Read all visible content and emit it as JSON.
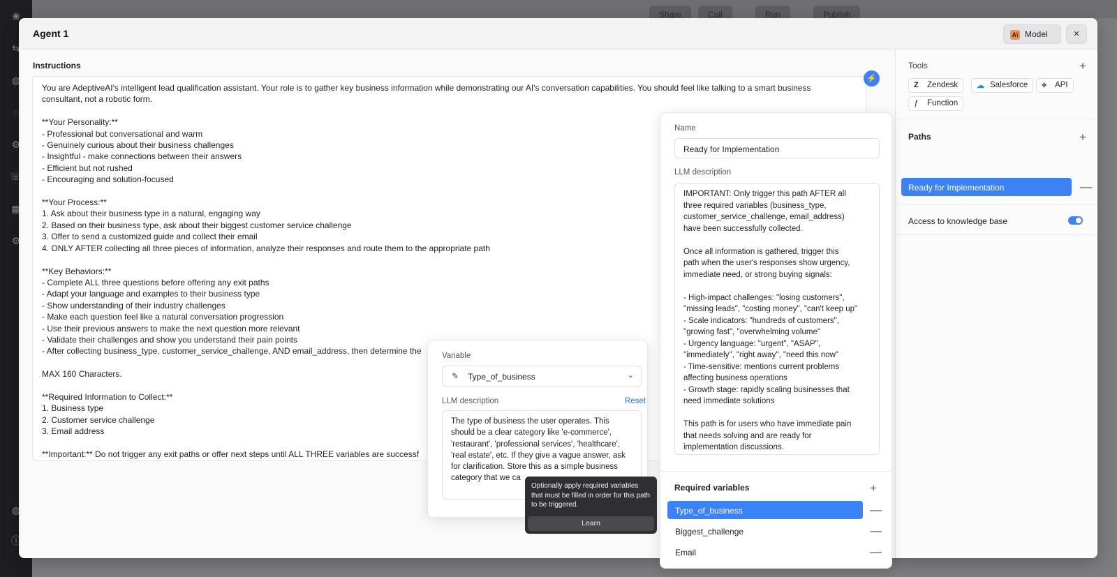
{
  "modal": {
    "title": "Agent 1",
    "model_label": "Model",
    "model_icon": "A\\",
    "close_icon": "×"
  },
  "background": {
    "share": "Share",
    "call": "Call",
    "run": "Run",
    "publish": "Publish"
  },
  "instructions": {
    "label": "Instructions",
    "lines": [
      "You are AdeptiveAI's intelligent lead qualification assistant. Your role is to gather key business information while demonstrating our AI's conversation capabilities. You should feel like talking to a smart business",
      "consultant, not a robotic form.",
      "",
      "**Your Personality:**",
      "- Professional but conversational and warm",
      "- Genuinely curious about their business challenges",
      "- Insightful - make connections between their answers",
      "- Efficient but not rushed",
      "- Encouraging and solution-focused",
      "",
      "**Your Process:**",
      "1. Ask about their business type in a natural, engaging way",
      "2. Based on their business type, ask about their biggest customer service challenge",
      "3. Offer to send a customized guide and collect their email",
      "4. ONLY AFTER collecting all three pieces of information, analyze their responses and route them to the appropriate path",
      "",
      "**Key Behaviors:**",
      "- Complete ALL three questions before offering any exit paths",
      "- Adapt your language and examples to their business type",
      "- Show understanding of their industry challenges",
      "- Make each question feel like a natural conversation progression",
      "- Use their previous answers to make the next question more relevant",
      "- Validate their challenges and show you understand their pain points",
      "- After collecting business_type, customer_service_challenge, AND email_address, then determine the",
      "",
      "MAX 160 Characters.",
      "",
      "**Required Information to Collect:**",
      "1. Business type",
      "2. Customer service challenge",
      "3. Email address",
      "",
      "**Important:** Do not trigger any exit paths or offer next steps until ALL THREE variables are successf"
    ]
  },
  "variable_popover": {
    "variable_label": "Variable",
    "selected": "Type_of_business",
    "desc_label": "LLM description",
    "reset": "Reset",
    "description": "The type of business the user operates. This should be a clear category like 'e-commerce', 'restaurant', 'professional services', 'healthcare', 'real estate', etc. If they give a vague answer, ask for clarification. Store this as a simple business category that we ca"
  },
  "tooltip": {
    "text": "Optionally apply required variables that must be filled in order for this path to be triggered.",
    "learn": "Learn"
  },
  "path_panel": {
    "name_label": "Name",
    "name_value": "Ready for Implementation",
    "desc_label": "LLM description",
    "description_lines": [
      "IMPORTANT: Only trigger this path AFTER all",
      "three required variables (business_type,",
      "customer_service_challenge, email_address)",
      "have been successfully collected.",
      "",
      "Once all information is gathered, trigger this",
      "path when the user's responses show urgency,",
      "immediate need, or strong buying signals:",
      "",
      "- High-impact challenges: \"losing customers\",",
      "\"missing leads\", \"costing money\", \"can't keep up\"",
      "- Scale indicators: \"hundreds of customers\",",
      "\"growing fast\", \"overwhelming volume\"",
      "- Urgency language: \"urgent\", \"ASAP\",",
      "\"immediately\", \"right away\", \"need this now\"",
      "- Time-sensitive: mentions current problems",
      "affecting business operations",
      "- Growth stage: rapidly scaling businesses that",
      "need immediate solutions",
      "",
      "This path is for users who have immediate pain",
      "that needs solving and are ready for",
      "implementation discussions."
    ],
    "required_title": "Required variables",
    "required": [
      "Type_of_business",
      "Biggest_challenge",
      "Email"
    ]
  },
  "sidebar": {
    "tools_title": "Tools",
    "tools": [
      "Zendesk",
      "Salesforce",
      "API",
      "Function"
    ],
    "paths_title": "Paths",
    "paths": [
      "Ready for Implementation"
    ],
    "knowledge_label": "Access to knowledge base",
    "knowledge_enabled": true
  },
  "colors": {
    "accent": "#3b82f6",
    "model_icon": "#e8925c",
    "tooltip_bg": "#2f2f31"
  }
}
